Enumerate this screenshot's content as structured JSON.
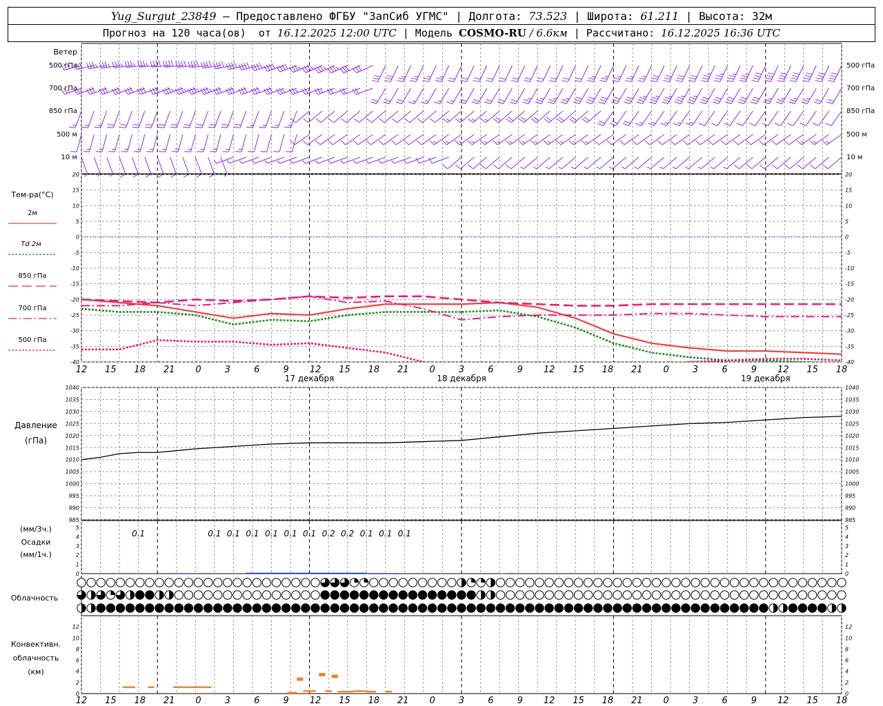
{
  "header": {
    "station": "Yug_Surgut_23849",
    "dash": " — ",
    "provider": "Предоставлено ФГБУ \"ЗапСиб УГМС\"",
    "sep": " | ",
    "lon_label": "Долгота: ",
    "lon": "73.523",
    "lat_label": "Широта: ",
    "lat": "61.211",
    "alt_label": "Высота: ",
    "alt": "32м",
    "forecast_label": "Прогноз на 120 часа(ов)  от ",
    "forecast_start": "16.12.2025 12:00 UTC",
    "model_label": "Модель ",
    "model": "COSMO-RU",
    "model_res": " / 6.6км",
    "calc_label": "Рассчитано: ",
    "calc_time": "16.12.2025 16:36 UTC"
  },
  "colors": {
    "barb": "#8a2be2",
    "t2m": "#f04040",
    "td2m": "#228b22",
    "t850": "#e0207a",
    "t700": "#e0207a",
    "t500": "#e0207a",
    "zero": "#4060d0",
    "pressure": "#000000",
    "precip": "#2040c0",
    "conv": "#f08020"
  },
  "chart_data": [
    {
      "type": "wind-barbs",
      "panel": "wind",
      "title": "Ветер",
      "levels": [
        "500 гПа",
        "700 гПа",
        "850 гПа",
        "500 м",
        "10  м"
      ],
      "note": "wind barbs at each level, direction and speed shown graphically"
    },
    {
      "type": "line",
      "panel": "temperature",
      "ylabel": "Тем-ра(°С)",
      "ylim": [
        -40,
        20
      ],
      "yticks": [
        20,
        15,
        10,
        5,
        0,
        -5,
        -10,
        -15,
        -20,
        -25,
        -30,
        -35,
        -40
      ],
      "x": [
        0,
        6,
        12,
        18,
        24,
        30,
        36,
        42,
        48,
        54,
        60,
        66,
        72,
        78,
        84,
        90,
        96,
        102,
        108,
        114,
        120
      ],
      "series": [
        {
          "name": "2м",
          "values": [
            -20,
            -21,
            -22,
            -24,
            -26,
            -24.5,
            -25,
            -23,
            -21.5,
            -21.5,
            -21.5,
            -21,
            -22.5,
            -26,
            -31,
            -34,
            -35.5,
            -36.5,
            -36.5,
            -37,
            -37.5
          ]
        },
        {
          "name": "Td 2м",
          "values": [
            -23,
            -24,
            -24,
            -25,
            -28,
            -26.5,
            -27,
            -25,
            -24,
            -24,
            -24,
            -23.5,
            -25.5,
            -29,
            -34,
            -37,
            -38.5,
            -39.5,
            -39.5,
            -40,
            -40.5
          ]
        },
        {
          "name": "850 гПа",
          "values": [
            -20,
            -20.5,
            -21,
            -20,
            -20.5,
            -20,
            -19,
            -19.5,
            -19,
            -19,
            -20,
            -21,
            -21.5,
            -22,
            -22,
            -21.5,
            -21.5,
            -21.5,
            -21.5,
            -21.5,
            -21.5
          ]
        },
        {
          "name": "700 гПа",
          "values": [
            -22,
            -22,
            -21,
            -22,
            -21,
            -20,
            -19,
            -21,
            -20.5,
            -23,
            -26.5,
            -25.5,
            -25,
            -25,
            -25,
            -24.5,
            -24.5,
            -25,
            -25.5,
            -25.5,
            -25.5
          ]
        },
        {
          "name": "500 гПа",
          "values": [
            -36,
            -36,
            -33,
            -33.5,
            -33.5,
            -34.5,
            -34,
            -35.5,
            -37,
            -40,
            -43,
            -44,
            -45,
            -44.5,
            -43,
            -41,
            -40,
            -39.5,
            -39,
            -39,
            -39.5
          ]
        }
      ]
    },
    {
      "type": "line",
      "panel": "pressure",
      "ylabel": "Давление",
      "ylabel2": "(гПа)",
      "ylim": [
        985,
        1040
      ],
      "yticks": [
        1040,
        1035,
        1030,
        1025,
        1020,
        1015,
        1010,
        1005,
        1000,
        995,
        990,
        985
      ],
      "x": [
        0,
        3,
        6,
        9,
        12,
        18,
        24,
        30,
        36,
        42,
        48,
        54,
        60,
        66,
        72,
        78,
        84,
        90,
        96,
        102,
        108,
        114,
        120
      ],
      "series": [
        {
          "name": "Давление",
          "values": [
            1010,
            1011,
            1012.5,
            1013,
            1013,
            1014.5,
            1015.5,
            1016.5,
            1017,
            1017,
            1017,
            1017.5,
            1018,
            1019.5,
            1021,
            1022,
            1023,
            1024,
            1025,
            1025.5,
            1026.5,
            1027.5,
            1028
          ]
        }
      ]
    },
    {
      "type": "bar",
      "panel": "precipitation",
      "ylabel_3h": "(мм/3ч.)",
      "ylabel": "Осадки",
      "ylabel_1h": "(мм/1ч.)",
      "ylim": [
        0,
        5
      ],
      "yticks": [
        5,
        4,
        3,
        2,
        1,
        0
      ],
      "labels": [
        {
          "x": 9,
          "value": "0.1"
        },
        {
          "x": 21,
          "value": "0.1"
        },
        {
          "x": 24,
          "value": "0.1"
        },
        {
          "x": 27,
          "value": "0.1"
        },
        {
          "x": 30,
          "value": "0.1"
        },
        {
          "x": 33,
          "value": "0.1"
        },
        {
          "x": 36,
          "value": "0.1"
        },
        {
          "x": 39,
          "value": "0.2"
        },
        {
          "x": 42,
          "value": "0.2"
        },
        {
          "x": 45,
          "value": "0.1"
        },
        {
          "x": 48,
          "value": "0.1"
        },
        {
          "x": 51,
          "value": "0.1"
        }
      ],
      "hourly": [
        {
          "x0": 7,
          "x1": 9,
          "value": 0.05
        },
        {
          "x0": 15,
          "x1": 18,
          "value": 0.05
        },
        {
          "x0": 19,
          "x1": 20,
          "value": 0.05
        },
        {
          "x0": 26,
          "x1": 45,
          "value": 0.1
        },
        {
          "x0": 45,
          "x1": 50,
          "value": 0.06
        },
        {
          "x0": 66,
          "x1": 67,
          "value": 0.04
        }
      ]
    },
    {
      "type": "table",
      "panel": "cloudiness",
      "title": "Облачность",
      "rows": 3,
      "cols": 49,
      "cover": [
        [
          0,
          0,
          0,
          0,
          0,
          0,
          0,
          0,
          0,
          0,
          0,
          0,
          0,
          0,
          0,
          0,
          0,
          0,
          0,
          0,
          0,
          0,
          0,
          0,
          0,
          0,
          0,
          0,
          0,
          0,
          0,
          0,
          0,
          0,
          0,
          0,
          0,
          0,
          0,
          0,
          0,
          0,
          0,
          0,
          0,
          0,
          0,
          0,
          0,
          0,
          0,
          0,
          0,
          0,
          0,
          0,
          0,
          0,
          0,
          0,
          0,
          0,
          0,
          0,
          0,
          0,
          0,
          0,
          0,
          0,
          0,
          0,
          0,
          0,
          0,
          0,
          0,
          0,
          0,
          0,
          0,
          0,
          0,
          0,
          0,
          0,
          0,
          0,
          0,
          0,
          0,
          0,
          0,
          0,
          0,
          0,
          0,
          0,
          0,
          0,
          0,
          0,
          0,
          0,
          0,
          0,
          0,
          0,
          0,
          0,
          0,
          0,
          0,
          0,
          0,
          0,
          0
        ],
        [
          6,
          4,
          2,
          4,
          8,
          8,
          8,
          8,
          8,
          8,
          6,
          4,
          2,
          2,
          0,
          0,
          0,
          0,
          0,
          0,
          0,
          0,
          0,
          0,
          0,
          0,
          0,
          0,
          0,
          0,
          0,
          0,
          0,
          0,
          0,
          0,
          0,
          0,
          0,
          0,
          0,
          0,
          0,
          0,
          0,
          0,
          0,
          0,
          0,
          0,
          0,
          0,
          0,
          0,
          0,
          0,
          0,
          8,
          8,
          8,
          8,
          8,
          8,
          8,
          8,
          8,
          8,
          8,
          8,
          8,
          8,
          8,
          8,
          8,
          8,
          8,
          8,
          8,
          8,
          8,
          8,
          8,
          8,
          8,
          8,
          8,
          8,
          8,
          8,
          8,
          8,
          8,
          8,
          8,
          8,
          8,
          8,
          8,
          8,
          4,
          2,
          0,
          0,
          0,
          0,
          0,
          0,
          0,
          0,
          0,
          0,
          0,
          0,
          0,
          0,
          0,
          0,
          0
        ],
        [
          4,
          4,
          8,
          8,
          8,
          8,
          8,
          8,
          8,
          8,
          8,
          8,
          8,
          8,
          8,
          8,
          8,
          8,
          8,
          8,
          8,
          8,
          8,
          8,
          8,
          8,
          8,
          8,
          8,
          8,
          8,
          8,
          8,
          8,
          8,
          8,
          8,
          8,
          8,
          8,
          8,
          8,
          8,
          8,
          8,
          8,
          8,
          8,
          8,
          8,
          8,
          8,
          8,
          8,
          8,
          8,
          8,
          8,
          8,
          8,
          8,
          8,
          8,
          8,
          8,
          8,
          8,
          8,
          8,
          8,
          8,
          8,
          8,
          8,
          8,
          8,
          8,
          8,
          8,
          8,
          8,
          8,
          8,
          8,
          8,
          8,
          8,
          8,
          8,
          8,
          8,
          8,
          8,
          8,
          8,
          8,
          8,
          8,
          8,
          8,
          8,
          8,
          8,
          8,
          8,
          8,
          8,
          8,
          8,
          8,
          8,
          8,
          8,
          8,
          8,
          8,
          8,
          8,
          8
        ]
      ]
    },
    {
      "type": "bar",
      "panel": "convective",
      "ylabel": [
        "Конвективн.",
        "облачность",
        "(км)"
      ],
      "ylim": [
        0,
        14
      ],
      "yticks": [
        12,
        10,
        8,
        6,
        4,
        2,
        0
      ],
      "segments": [
        {
          "x0": 6.5,
          "x1": 8.5,
          "bottom": 1.0,
          "top": 1.3
        },
        {
          "x0": 10.5,
          "x1": 11.5,
          "bottom": 1.0,
          "top": 1.3
        },
        {
          "x0": 14.5,
          "x1": 20.5,
          "bottom": 1.0,
          "top": 1.3
        },
        {
          "x0": 32.5,
          "x1": 34,
          "bottom": 0,
          "top": 0.3
        },
        {
          "x0": 34,
          "x1": 35,
          "bottom": 2.3,
          "top": 2.9
        },
        {
          "x0": 35,
          "x1": 37,
          "bottom": 0.3,
          "top": 0.6
        },
        {
          "x0": 37.5,
          "x1": 38.5,
          "bottom": 3.1,
          "top": 3.7
        },
        {
          "x0": 38.5,
          "x1": 39.5,
          "bottom": 0.3,
          "top": 0.6
        },
        {
          "x0": 39.5,
          "x1": 40.5,
          "bottom": 2.8,
          "top": 3.4
        },
        {
          "x0": 40.5,
          "x1": 43,
          "bottom": 0.2,
          "top": 0.5
        },
        {
          "x0": 43,
          "x1": 45,
          "bottom": 0.3,
          "top": 0.6
        },
        {
          "x0": 45,
          "x1": 46.5,
          "bottom": 0.2,
          "top": 0.5
        },
        {
          "x0": 48,
          "x1": 49,
          "bottom": 0.2,
          "top": 0.5
        }
      ]
    }
  ],
  "time_axis": {
    "hour_labels": [
      "12",
      "15",
      "18",
      "21",
      "0",
      "3",
      "6",
      "9",
      "12",
      "15",
      "18",
      "21",
      "0",
      "3",
      "6",
      "9",
      "12",
      "15",
      "18",
      "21",
      "0",
      "3",
      "6",
      "9",
      "12",
      "15",
      "18"
    ],
    "day_labels": [
      {
        "x": 36,
        "text": "17 декабря"
      },
      {
        "x": 60,
        "text": "18 декабря"
      },
      {
        "x": 108,
        "text": "19 декабря"
      }
    ],
    "range_hours": 120
  }
}
